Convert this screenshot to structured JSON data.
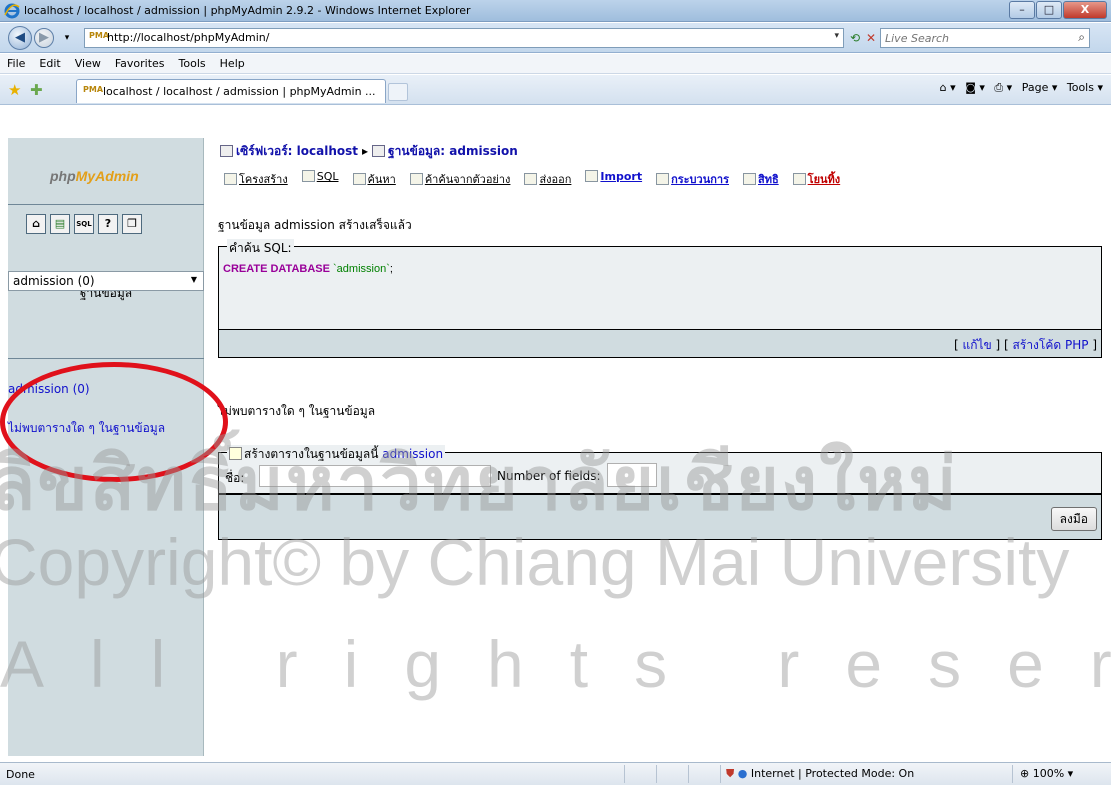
{
  "window": {
    "title": "localhost / localhost / admission | phpMyAdmin 2.9.2 - Windows Internet Explorer",
    "minimize": "–",
    "maximize": "□",
    "close": "X"
  },
  "address_bar": {
    "url": "http://localhost/phpMyAdmin/",
    "search_placeholder": "Live Search"
  },
  "menu": [
    "File",
    "Edit",
    "View",
    "Favorites",
    "Tools",
    "Help"
  ],
  "tab": {
    "label": "localhost / localhost / admission | phpMyAdmin ..."
  },
  "command_bar": {
    "page": "Page ▾",
    "tools": "Tools ▾"
  },
  "left_frame": {
    "logo_php": "php",
    "logo_myadmin": "MyAdmin",
    "database_label": "ฐานข้อมูล",
    "database_select": "admission (0)",
    "database_link": "admission (0)",
    "no_tables": "ไม่พบตารางใด ๆ ในฐานข้อมูล"
  },
  "breadcrumb": {
    "server": "เซิร์ฟเวอร์: localhost",
    "database": "ฐานข้อมูล: admission"
  },
  "tabs": [
    {
      "label": "โครงสร้าง"
    },
    {
      "label": "SQL"
    },
    {
      "label": "ค้นหา"
    },
    {
      "label": "ค้าค้นจากตัวอย่าง"
    },
    {
      "label": "ส่งออก"
    },
    {
      "label": "Import"
    },
    {
      "label": "กระบวนการ"
    },
    {
      "label": "สิทธิ"
    },
    {
      "label": "โยนทิ้ง"
    }
  ],
  "main": {
    "success_message": "ฐานข้อมูล admission สร้างเสร็จแล้ว",
    "sql_legend": "คำค้น SQL:",
    "sql_keyword": "CREATE DATABASE",
    "sql_string": "`admission`",
    "sql_end": ";",
    "edit_link": "แก้ไข",
    "php_link": "สร้างโค้ด PHP",
    "no_tables": "ไม่พบตารางใด ๆ ในฐานข้อมูล",
    "create_legend": "สร้างตารางในฐานข้อมูลนี้",
    "create_db": "admission",
    "name_label": "ชื่อ:",
    "fields_label": "Number of fields:",
    "go_button": "ลงมือ"
  },
  "watermark": {
    "line1": "ลิขสิทธิ์มหาวิทยาลัยเชียงใหม่",
    "line2": "Copyright© by Chiang Mai University",
    "line3": "All rights reserved"
  },
  "status_bar": {
    "status": "Done",
    "zone": "Internet | Protected Mode: On",
    "zoom": "100%"
  }
}
